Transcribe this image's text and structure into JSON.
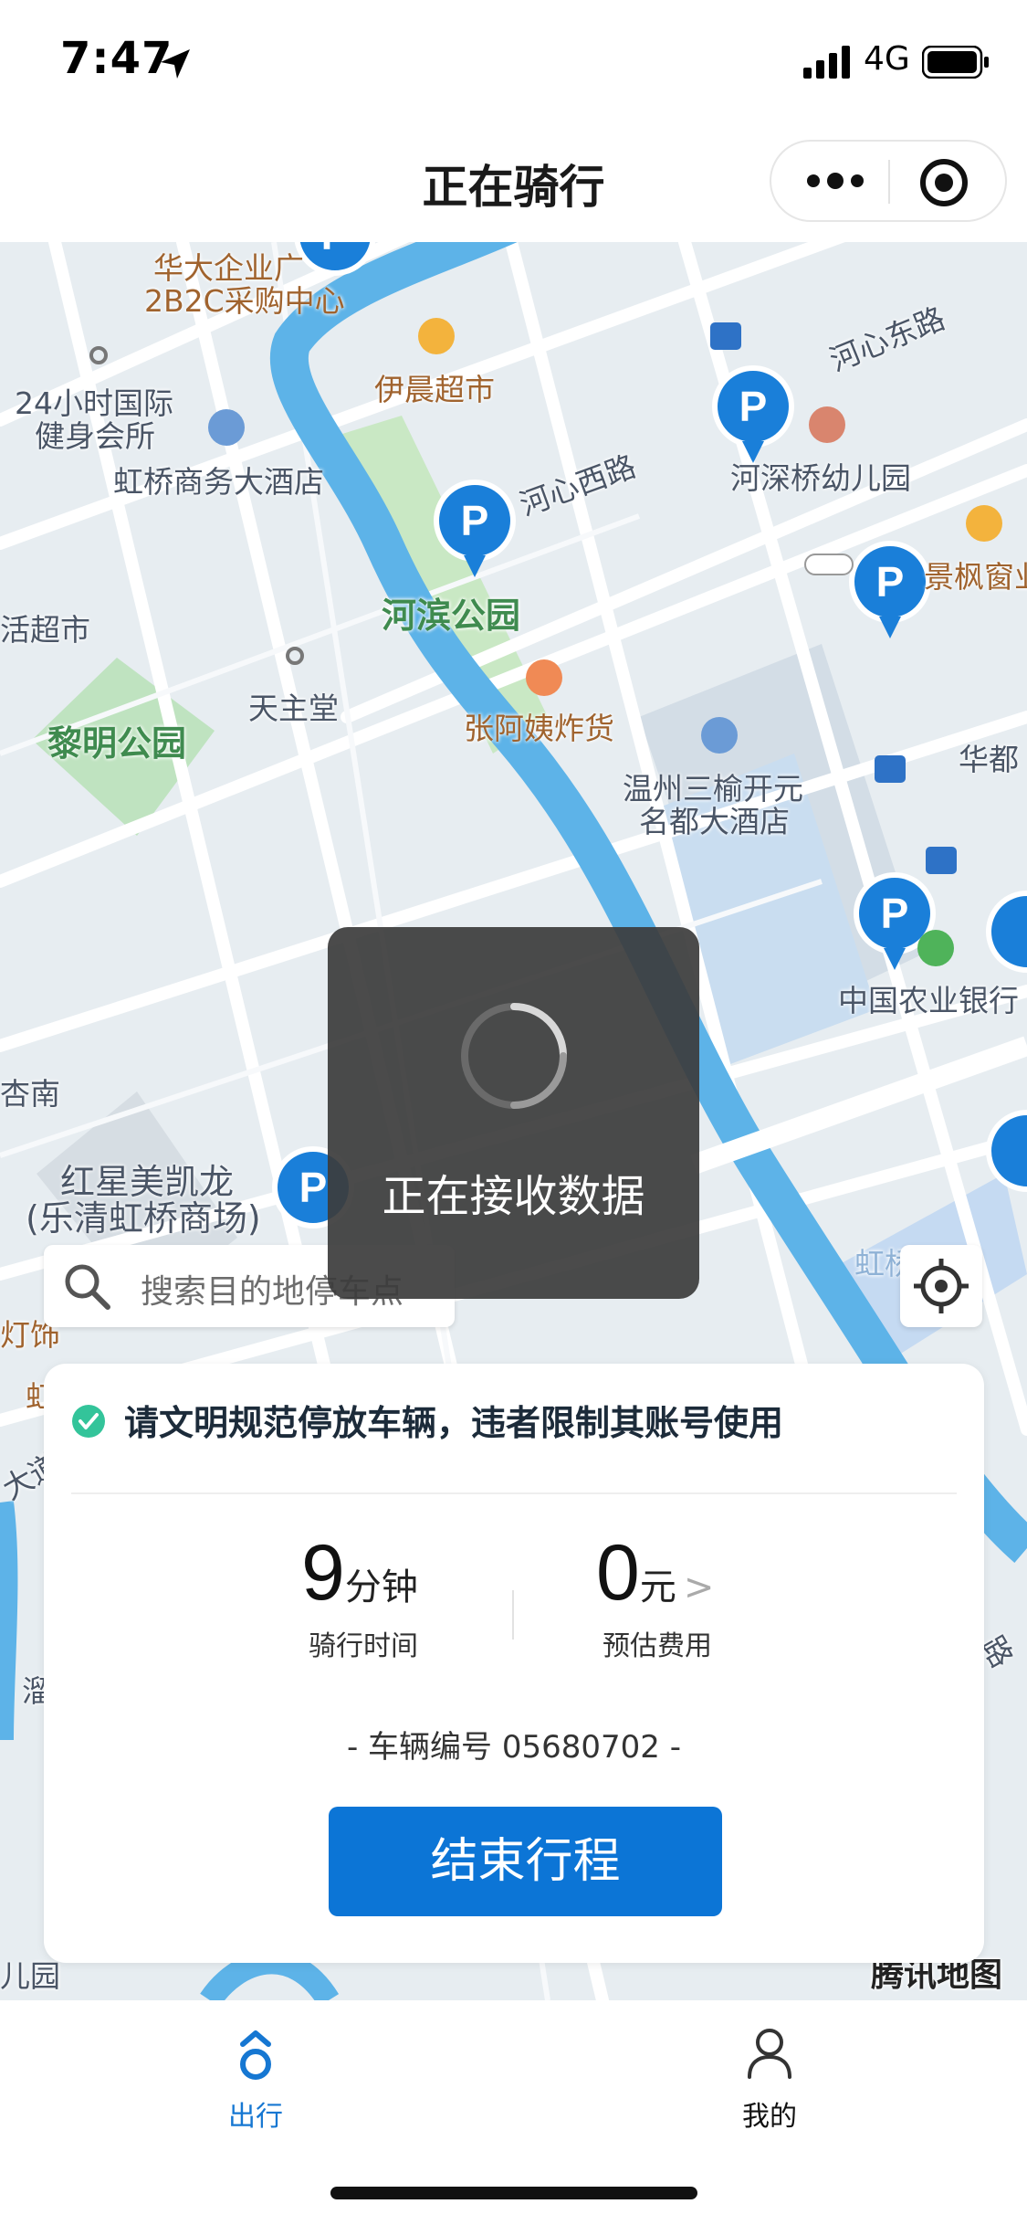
{
  "status_bar": {
    "time": "7:47",
    "network": "4G"
  },
  "nav": {
    "title": "正在骑行"
  },
  "map": {
    "labels": [
      {
        "id": "hd1",
        "text": "华大企业广"
      },
      {
        "id": "hd2",
        "text": "2B2C采购中心"
      },
      {
        "id": "yc",
        "text": "伊晨超市"
      },
      {
        "id": "hxd",
        "text": "河心东路"
      },
      {
        "id": "gym1",
        "text": "24小时国际"
      },
      {
        "id": "gym2",
        "text": "健身会所"
      },
      {
        "id": "hq",
        "text": "虹桥商务大酒店"
      },
      {
        "id": "hxx",
        "text": "河心西路"
      },
      {
        "id": "hsq",
        "text": "河深桥幼儿园"
      },
      {
        "id": "jf",
        "text": "景枫窗业"
      },
      {
        "id": "hcs",
        "text": "活超市"
      },
      {
        "id": "hbgy",
        "text": "河滨公园"
      },
      {
        "id": "tzt",
        "text": "天主堂"
      },
      {
        "id": "lmgy",
        "text": "黎明公园"
      },
      {
        "id": "zay",
        "text": "张阿姨炸货"
      },
      {
        "id": "ws1",
        "text": "温州三榆开元"
      },
      {
        "id": "ws2",
        "text": "名都大酒店"
      },
      {
        "id": "hd",
        "text": "华都"
      },
      {
        "id": "nyyh",
        "text": "中国农业银行"
      },
      {
        "id": "xn",
        "text": "杏南"
      },
      {
        "id": "hx1",
        "text": "红星美凯龙"
      },
      {
        "id": "hx2",
        "text": "(乐清虹桥商场)"
      },
      {
        "id": "hq2",
        "text": "虹桥区"
      },
      {
        "id": "dsh",
        "text": "灯饰"
      },
      {
        "id": "hong",
        "text": "虹"
      },
      {
        "id": "dao",
        "text": "大道"
      },
      {
        "id": "lu",
        "text": "路"
      },
      {
        "id": "pu",
        "text": "溜"
      },
      {
        "id": "er",
        "text": "儿园"
      }
    ],
    "watermark": "腾讯地图",
    "parking_icon": "P"
  },
  "toast": {
    "text": "正在接收数据"
  },
  "search": {
    "placeholder": "搜索目的地停车点"
  },
  "card": {
    "notice": "请文明规范停放车辆，违者限制其账号使用",
    "ride_time": {
      "value": "9",
      "unit": "分钟",
      "label": "骑行时间"
    },
    "fee": {
      "value": "0",
      "unit": "元",
      "arrow": ">",
      "label": "预估费用"
    },
    "vehicle": "- 车辆编号 05680702 -",
    "end_button": "结束行程"
  },
  "tabbar": {
    "items": [
      {
        "label": "出行",
        "icon": "ride-icon",
        "active": true
      },
      {
        "label": "我的",
        "icon": "user-icon",
        "active": false
      }
    ],
    "active_color": "#1677d2"
  },
  "colors": {
    "primary": "#0c75d6",
    "water": "#5db3e8",
    "park": "#bfe3c0",
    "parking_pin": "#1a7fd9",
    "notice_check": "#33c49a"
  }
}
